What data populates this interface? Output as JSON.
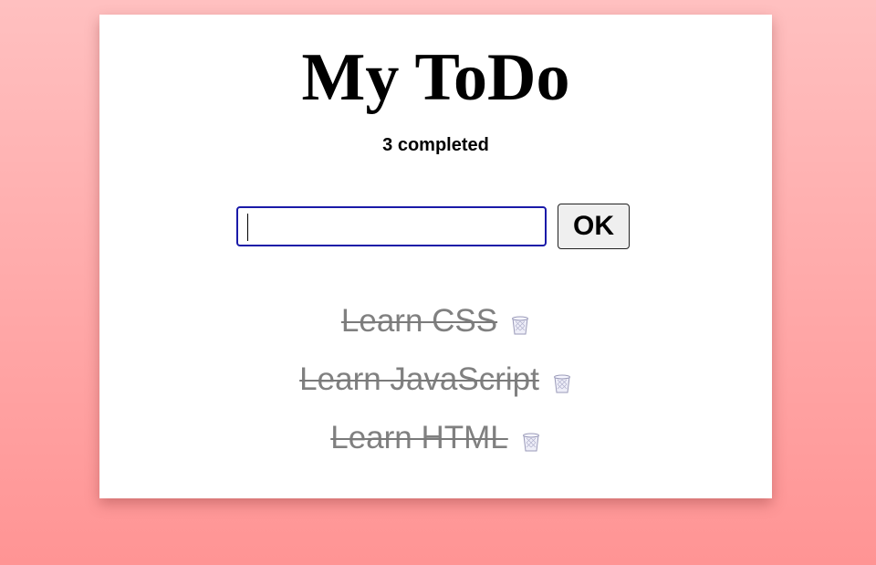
{
  "header": {
    "title": "My ToDo",
    "completed_text": "3 completed"
  },
  "form": {
    "input_value": "",
    "input_placeholder": "",
    "ok_label": "OK"
  },
  "todos": [
    {
      "label": "Learn CSS",
      "completed": true,
      "delete_icon": "trash-icon"
    },
    {
      "label": "Learn JavaScript",
      "completed": true,
      "delete_icon": "trash-icon"
    },
    {
      "label": "Learn HTML",
      "completed": true,
      "delete_icon": "trash-icon"
    }
  ],
  "colors": {
    "background_top": "#ffc0c0",
    "background_bottom": "#ff9494",
    "completed_text": "#808080",
    "input_border": "#1a1aa8"
  }
}
